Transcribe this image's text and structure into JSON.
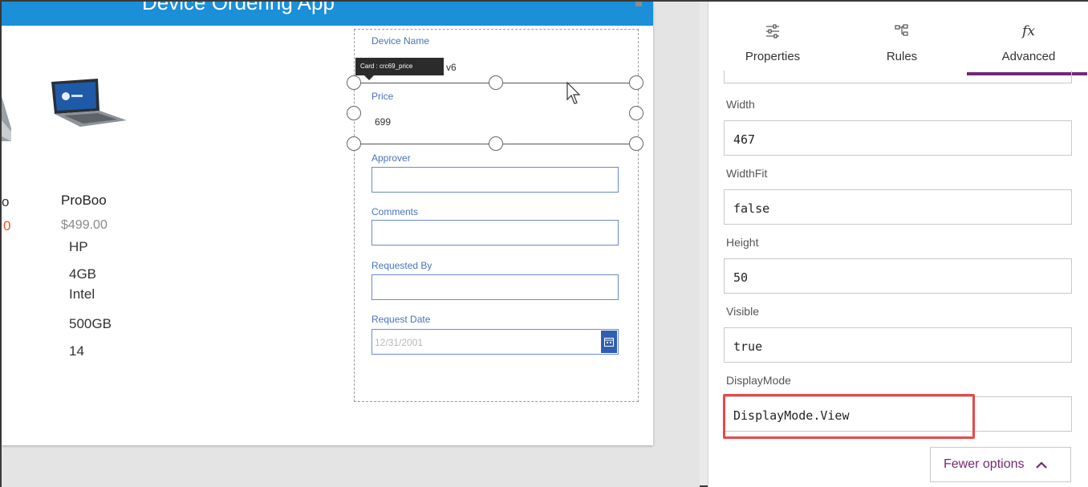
{
  "app": {
    "title": "Device Ordering App"
  },
  "gallery": {
    "partial_left_name": "o",
    "partial_left_price": "0",
    "item": {
      "name": "ProBoo",
      "price": "$499.00",
      "lines": [
        "HP",
        "4GB",
        "Intel",
        "500GB",
        "14"
      ]
    }
  },
  "form": {
    "device_name_label": "Device Name",
    "device_name_value": "v6",
    "tooltip": "Card : crc69_price",
    "price_label": "Price",
    "price_value": "699",
    "approver_label": "Approver",
    "comments_label": "Comments",
    "requested_by_label": "Requested By",
    "request_date_label": "Request Date",
    "request_date_placeholder": "12/31/2001"
  },
  "panel": {
    "tabs": [
      {
        "label": "Properties",
        "icon": "sliders-icon"
      },
      {
        "label": "Rules",
        "icon": "rules-icon"
      },
      {
        "label": "Advanced",
        "icon": "fx-icon",
        "icon_text": "fx",
        "active": true
      }
    ],
    "properties": [
      {
        "label": "Width",
        "value": "467"
      },
      {
        "label": "WidthFit",
        "value": "false"
      },
      {
        "label": "Height",
        "value": "50"
      },
      {
        "label": "Visible",
        "value": "true"
      },
      {
        "label": "DisplayMode",
        "value": "DisplayMode.View"
      }
    ],
    "fewer_options_label": "Fewer options"
  },
  "colors": {
    "header_blue": "#1b8fd8",
    "accent_purple": "#742774",
    "highlight_red": "#e8494b",
    "form_label_blue": "#4a73b9"
  }
}
